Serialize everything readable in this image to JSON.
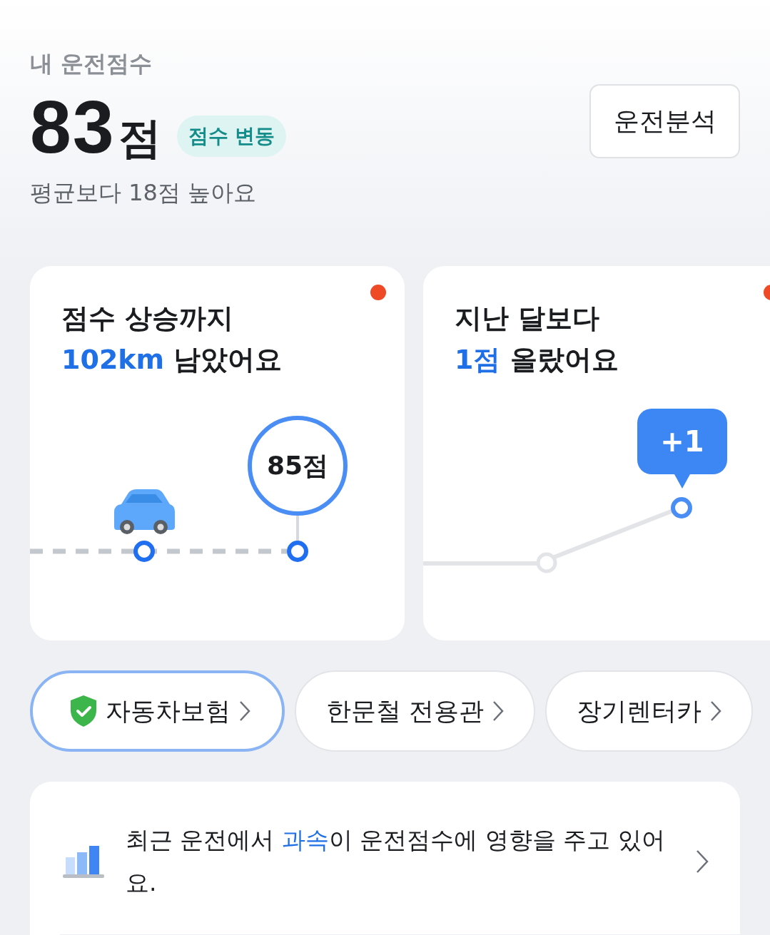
{
  "header": {
    "label": "내 운전점수",
    "score": "83",
    "unit": "점",
    "badge": "점수 변동",
    "comparison": "평균보다 18점 높아요",
    "button": "운전분석"
  },
  "cards": [
    {
      "kind": "distance",
      "new": true,
      "line1": "점수 상승까지",
      "highlight": "102km",
      "rest": " 남았어요",
      "target": "85점"
    },
    {
      "kind": "trend",
      "new": true,
      "line1": "지난 달보다",
      "highlight": "1점",
      "rest": " 올랐어요",
      "bubble": "+1"
    }
  ],
  "chips": [
    {
      "kind": "shield",
      "label": "자동차보험",
      "selected": true
    },
    {
      "kind": "plain",
      "label": "한문철 전용관",
      "selected": false
    },
    {
      "kind": "plain",
      "label": "장기렌터카",
      "selected": false
    }
  ],
  "insight": {
    "before": "최근 운전에서 ",
    "highlight": "과속",
    "after": "이 운전점수에 영향을 주고 있어요."
  }
}
